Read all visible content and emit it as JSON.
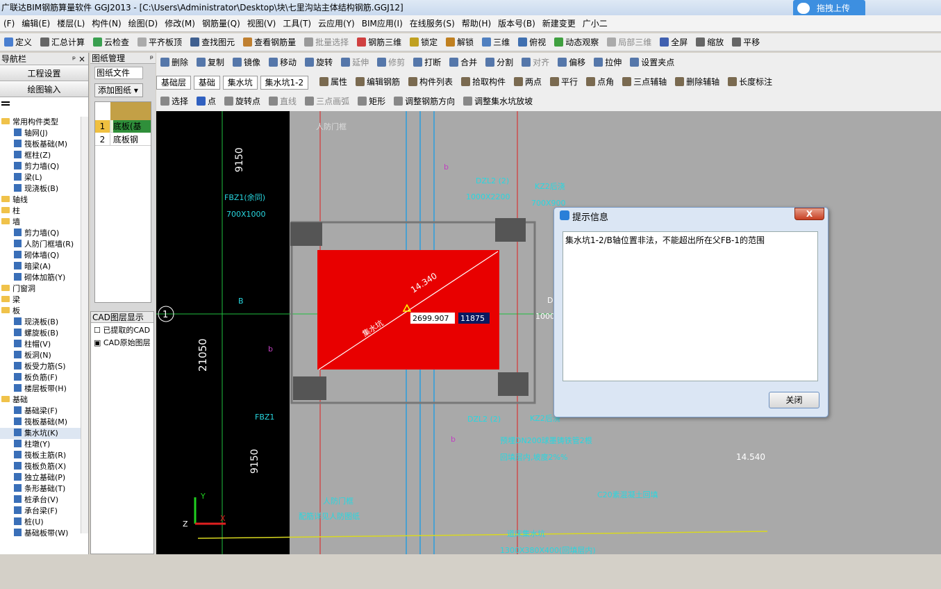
{
  "window": {
    "title": "广联达BIM钢筋算量软件 GGJ2013 - [C:\\Users\\Administrator\\Desktop\\块\\七里沟站主体结构钢筋.GGJ12]",
    "upload_label": "拖拽上传"
  },
  "menu": [
    "(F)",
    "编辑(E)",
    "楼层(L)",
    "构件(N)",
    "绘图(D)",
    "修改(M)",
    "钢筋量(Q)",
    "视图(V)",
    "工具(T)",
    "云应用(Y)",
    "BIM应用(I)",
    "在线服务(S)",
    "帮助(H)",
    "版本号(B)",
    "新建变更",
    "广小二"
  ],
  "toolbar1": [
    "定义",
    "汇总计算",
    "云检查",
    "平齐板顶",
    "查找图元",
    "查看钢筋量",
    "批量选择",
    "钢筋三维",
    "锁定",
    "解锁",
    "三维",
    "俯视",
    "动态观察",
    "局部三维",
    "全屏",
    "缩放",
    "平移"
  ],
  "toolbar2": [
    "删除",
    "复制",
    "镜像",
    "移动",
    "旋转",
    "延伸",
    "修剪",
    "打断",
    "合并",
    "分割",
    "对齐",
    "偏移",
    "拉伸",
    "设置夹点"
  ],
  "toolbar3": {
    "floor": "基础层",
    "type": "基础",
    "comp": "集水坑",
    "item": "集水坑1-2",
    "btns": [
      "属性",
      "编辑钢筋",
      "构件列表",
      "拾取构件",
      "两点",
      "平行",
      "点角",
      "三点辅轴",
      "删除辅轴",
      "长度标注"
    ]
  },
  "toolbar4": [
    "选择",
    "点",
    "旋转点",
    "直线",
    "三点画弧",
    "矩形",
    "调整钢筋方向",
    "调整集水坑放坡"
  ],
  "nav": {
    "title": "导航栏",
    "pin": "ᵖ ×",
    "btn_settings": "工程设置",
    "btn_draw": "绘图输入",
    "tree": [
      {
        "t": "常用构件类型",
        "c": true
      },
      {
        "t": "轴网(J)"
      },
      {
        "t": "筏板基础(M)"
      },
      {
        "t": "框柱(Z)"
      },
      {
        "t": "剪力墙(Q)"
      },
      {
        "t": "梁(L)"
      },
      {
        "t": "现浇板(B)"
      },
      {
        "t": "轴线",
        "c": true
      },
      {
        "t": "柱",
        "c": true
      },
      {
        "t": "墙",
        "c": true
      },
      {
        "t": "剪力墙(Q)"
      },
      {
        "t": "人防门框墙(R)"
      },
      {
        "t": "砌体墙(Q)"
      },
      {
        "t": "暗梁(A)"
      },
      {
        "t": "砌体加筋(Y)"
      },
      {
        "t": "门窗洞",
        "c": true
      },
      {
        "t": "梁",
        "c": true
      },
      {
        "t": "板",
        "c": true
      },
      {
        "t": "现浇板(B)"
      },
      {
        "t": "螺旋板(B)"
      },
      {
        "t": "柱帽(V)"
      },
      {
        "t": "板洞(N)"
      },
      {
        "t": "板受力筋(S)"
      },
      {
        "t": "板负筋(F)"
      },
      {
        "t": "楼层板带(H)"
      },
      {
        "t": "基础",
        "c": true
      },
      {
        "t": "基础梁(F)"
      },
      {
        "t": "筏板基础(M)"
      },
      {
        "t": "集水坑(K)"
      },
      {
        "t": "柱墩(Y)"
      },
      {
        "t": "筏板主筋(R)"
      },
      {
        "t": "筏板负筋(X)"
      },
      {
        "t": "独立基础(P)"
      },
      {
        "t": "条形基础(T)"
      },
      {
        "t": "桩承台(V)"
      },
      {
        "t": "承台梁(F)"
      },
      {
        "t": "桩(U)"
      },
      {
        "t": "基础板带(W)"
      }
    ]
  },
  "drawing_panel": {
    "title": "图纸管理",
    "pin": "ᵖ",
    "tab": "图纸文件",
    "add": "添加图纸",
    "rows": [
      {
        "n": "1",
        "name": "底板(基"
      },
      {
        "n": "2",
        "name": "底板钢"
      }
    ]
  },
  "cad_panel": {
    "title": "CAD图层显示",
    "items": [
      "已提取的CAD",
      "CAD原始图层"
    ]
  },
  "canvas": {
    "labels": [
      "9150",
      "21050",
      "9150",
      "FBZ1(余同)",
      "700X1000",
      "人防门框",
      "DZL2 (2)",
      "1000X2200",
      "KZ2后浇",
      "700X900",
      "FBZ1",
      "DZL2 (2)",
      "KZ2后浇",
      "预埋DN200球墨铸铁管2根",
      "回填层内,坡度2%%",
      "人防门框",
      "配筋详见人防图纸",
      "道床集水坑",
      "1300X380X400(回填层内)",
      "C20素混凝土回填",
      "14.540",
      "b",
      "b",
      "b",
      "1",
      "B",
      "D",
      "1000"
    ],
    "pit_label": "集水坑",
    "dim_label": "14.340",
    "coord_x": "2699.907",
    "coord_y": "11875",
    "axis_y": "Y",
    "axis_x": "X",
    "axis_z": "Z"
  },
  "dialog": {
    "title": "提示信息",
    "close": "X",
    "message": "集水坑1-2/B轴位置非法，不能超出所在父FB-1的范围",
    "ok": "关闭"
  }
}
